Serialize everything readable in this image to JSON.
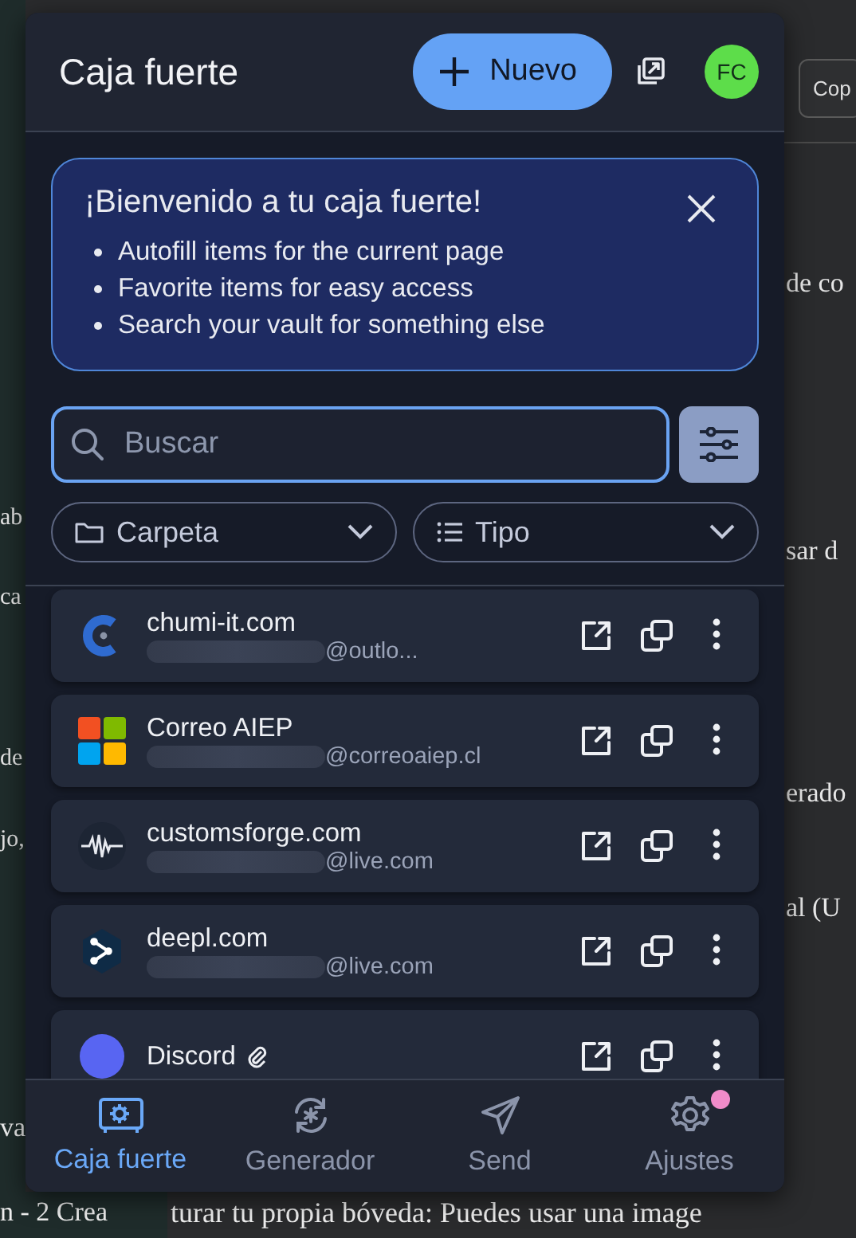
{
  "background": {
    "copy_button": "Cop",
    "left_fragments": [
      "ab",
      "ca",
      "de",
      "jo,"
    ],
    "left_bottom_fragment": "va",
    "right_fragments": [
      "de co",
      "sar d",
      "erado",
      "al (U"
    ],
    "bottom_left": "n - 2 Crea",
    "bottom_line": "turar tu propia bóveda: Puedes usar una image"
  },
  "header": {
    "title": "Caja fuerte",
    "new_button": "Nuevo",
    "avatar": "FC"
  },
  "welcome": {
    "title": "¡Bienvenido a tu caja fuerte!",
    "items": [
      "Autofill items for the current page",
      "Favorite items for easy access",
      "Search your vault for something else"
    ]
  },
  "search": {
    "placeholder": "Buscar"
  },
  "filters": [
    {
      "label": "Carpeta",
      "kind": "folder"
    },
    {
      "label": "Tipo",
      "kind": "type"
    }
  ],
  "items": [
    {
      "name": "chumi-it.com",
      "username": "@outlo...",
      "kind": "c-mark",
      "attachment": false
    },
    {
      "name": "Correo AIEP",
      "username": "@correoaiep.cl",
      "kind": "tiles",
      "attachment": false
    },
    {
      "name": "customsforge.com",
      "username": "@live.com",
      "kind": "wave",
      "attachment": false
    },
    {
      "name": "deepl.com",
      "username": "@live.com",
      "kind": "nodes",
      "attachment": false
    },
    {
      "name": "Discord",
      "kind": "circle",
      "attachment": true
    }
  ],
  "nav": [
    {
      "label": "Caja fuerte",
      "kind": "vault",
      "selected": true,
      "badge": false
    },
    {
      "label": "Generador",
      "kind": "generator",
      "selected": false,
      "badge": false
    },
    {
      "label": "Send",
      "kind": "send",
      "selected": false,
      "badge": false
    },
    {
      "label": "Ajustes",
      "kind": "gear",
      "selected": false,
      "badge": true
    }
  ]
}
